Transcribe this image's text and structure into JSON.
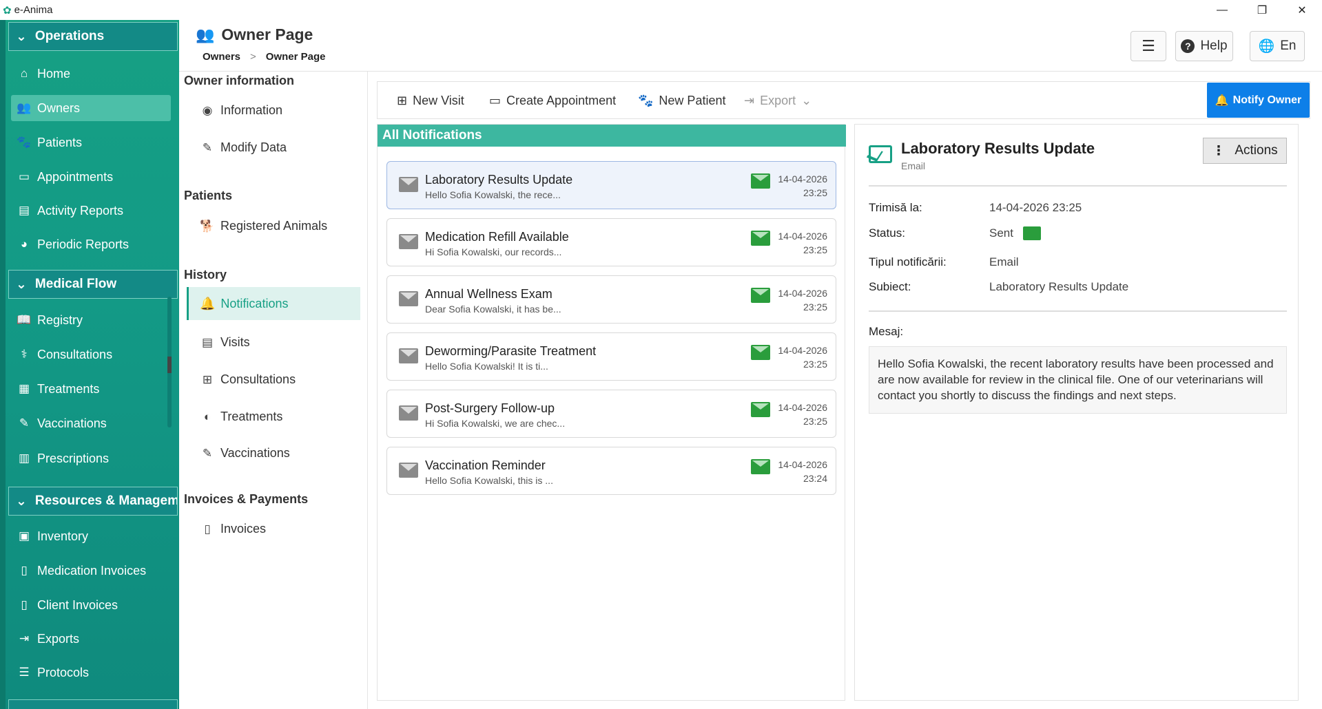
{
  "window": {
    "title": "e-Anima",
    "minimize": "—",
    "restore": "❐",
    "close": "✕"
  },
  "sidebar": {
    "groups": [
      {
        "label": "Operations"
      },
      {
        "label": "Medical Flow"
      },
      {
        "label": "Resources & Management"
      }
    ],
    "operations": [
      "Home",
      "Owners",
      "Patients",
      "Appointments",
      "Activity Reports",
      "Periodic Reports"
    ],
    "medical": [
      "Registry",
      "Consultations",
      "Treatments",
      "Vaccinations",
      "Prescriptions"
    ],
    "resources": [
      "Inventory",
      "Medication Invoices",
      "Client Invoices",
      "Exports",
      "Protocols"
    ],
    "active": "Owners"
  },
  "header": {
    "title": "Owner Page",
    "breadcrumb": [
      "Owners",
      "Owner Page"
    ],
    "help": "Help",
    "language": "En"
  },
  "leftnav": {
    "owner_info": "Owner information",
    "information": "Information",
    "modify": "Modify Data",
    "patients": "Patients",
    "registered": "Registered Animals",
    "history": "History",
    "notifications": "Notifications",
    "visits": "Visits",
    "consultations": "Consultations",
    "treatments": "Treatments",
    "vaccinations": "Vaccinations",
    "invoices_heading": "Invoices & Payments",
    "invoices": "Invoices"
  },
  "toolbar": {
    "new_visit": "New Visit",
    "create_appointment": "Create Appointment",
    "new_patient": "New Patient",
    "export": "Export",
    "notify_owner": "Notify Owner"
  },
  "notifications": {
    "heading": "All Notifications",
    "items": [
      {
        "title": "Laboratory Results Update",
        "snippet": "Hello Sofia Kowalski, the rece...",
        "date": "14-04-2026",
        "time": "23:25"
      },
      {
        "title": "Medication Refill Available",
        "snippet": "Hi Sofia Kowalski, our records...",
        "date": "14-04-2026",
        "time": "23:25"
      },
      {
        "title": "Annual Wellness Exam",
        "snippet": "Dear Sofia Kowalski, it has be...",
        "date": "14-04-2026",
        "time": "23:25"
      },
      {
        "title": "Deworming/Parasite Treatment",
        "snippet": "Hello Sofia Kowalski! It is ti...",
        "date": "14-04-2026",
        "time": "23:25"
      },
      {
        "title": "Post-Surgery Follow-up",
        "snippet": "Hi Sofia Kowalski, we are chec...",
        "date": "14-04-2026",
        "time": "23:25"
      },
      {
        "title": "Vaccination Reminder",
        "snippet": "Hello Sofia Kowalski, this is ...",
        "date": "14-04-2026",
        "time": "23:24"
      }
    ]
  },
  "detail": {
    "title": "Laboratory Results Update",
    "type": "Email",
    "actions": "Actions",
    "sent_label": "Trimisă la:",
    "sent_value": "14-04-2026 23:25",
    "status_label": "Status:",
    "status_value": "Sent",
    "kind_label": "Tipul notificării:",
    "kind_value": "Email",
    "subject_label": "Subiect:",
    "subject_value": "Laboratory Results Update",
    "message_label": "Mesaj:",
    "message": "Hello Sofia Kowalski, the recent laboratory results have been processed and are now available for review in the clinical file. One of our veterinarians will contact you shortly to discuss the findings and next steps."
  },
  "colors": {
    "brand": "#16a085",
    "notify": "#0d7fe8",
    "sent": "#2a9d3c"
  }
}
